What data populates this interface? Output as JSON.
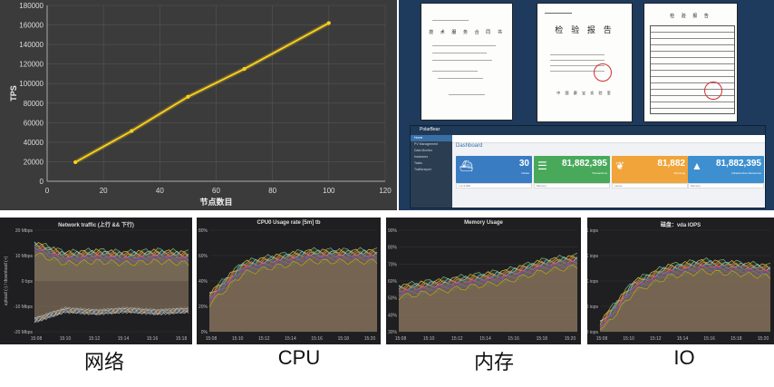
{
  "tps_chart": {
    "chart_data": {
      "type": "line",
      "ylabel": "TPS",
      "xlabel": "节点数目",
      "x_ticks": [
        "0",
        "20",
        "40",
        "60",
        "80",
        "100",
        "120"
      ],
      "y_ticks": [
        "0",
        "20000",
        "40000",
        "60000",
        "80000",
        "100000",
        "120000",
        "140000",
        "160000",
        "180000"
      ],
      "xlim": [
        0,
        120
      ],
      "ylim": [
        0,
        180000
      ],
      "series": [
        {
          "x": [
            10,
            30,
            50,
            70,
            100
          ],
          "y": [
            19500,
            51500,
            86500,
            115000,
            162000
          ]
        }
      ],
      "line_color": "#ffd21a"
    }
  },
  "documents": {
    "doc1": {
      "title": "技 术 服 务 合 同 书"
    },
    "doc2": {
      "title": "检 验 报 告",
      "footer": "中 国 赛 宝 实 验 室"
    },
    "doc3": {
      "title": "检 验 报 告"
    }
  },
  "dashboard": {
    "brand": "PolarBear",
    "title": "Dashboard",
    "sidebar": [
      "Home",
      "PV Management",
      "Data Monitor",
      "Instances",
      "Tasks",
      "Trafficreport"
    ],
    "cards": [
      {
        "value": "30",
        "label": "Nodes",
        "color": "#3a7cc2",
        "icon": "ship-icon",
        "foot": "1-2-3-400"
      },
      {
        "value": "81,882,395",
        "label": "Transactions",
        "color": "#48a95a",
        "icon": "rack-icon",
        "foot": "Memory"
      },
      {
        "value": "81,882",
        "label": "Warnings",
        "color": "#f0a43a",
        "icon": "leaf-icon",
        "foot": "Lanes"
      },
      {
        "value": "81,882,395",
        "label": "Infrastructure Resources",
        "color": "#3d8fd0",
        "icon": "a-icon",
        "foot": "Memory"
      }
    ]
  },
  "metrics": [
    {
      "title": "Network traffic (上行 && 下行)",
      "caption": "网络",
      "y_ticks": [
        "20 Mbps",
        "10 Mbps",
        "0 bps",
        "-10 Mbps",
        "-20 Mbps"
      ],
      "ylabel": "upload (-) / download (+)",
      "x_ticks": [
        "15:08",
        "15:10",
        "15:12",
        "15:14",
        "15:16",
        "15:18"
      ]
    },
    {
      "title": "CPU0 Usage rate [5m] tb",
      "caption": "CPU",
      "y_ticks": [
        "80%",
        "60%",
        "40%",
        "20%",
        "0%"
      ],
      "x_ticks": [
        "15:08",
        "15:10",
        "15:12",
        "15:14",
        "15:16",
        "15:18",
        "15:20"
      ]
    },
    {
      "title": "Memory Usage",
      "caption": "内存",
      "y_ticks": [
        "90%",
        "80%",
        "70%",
        "60%",
        "50%",
        "40%",
        "30%"
      ],
      "x_ticks": [
        "15:08",
        "15:10",
        "15:12",
        "15:14",
        "15:16",
        "15:18",
        "15:20"
      ]
    },
    {
      "title": "磁盘：vda IOPS",
      "caption": "IO",
      "y_ticks": [
        "2.0K iops",
        "1.5K iops",
        "1.0K iops",
        "500 iops",
        "0 iops"
      ],
      "x_ticks": [
        "15:08",
        "15:10",
        "15:12",
        "15:14",
        "15:16",
        "15:18",
        "15:20"
      ]
    }
  ]
}
